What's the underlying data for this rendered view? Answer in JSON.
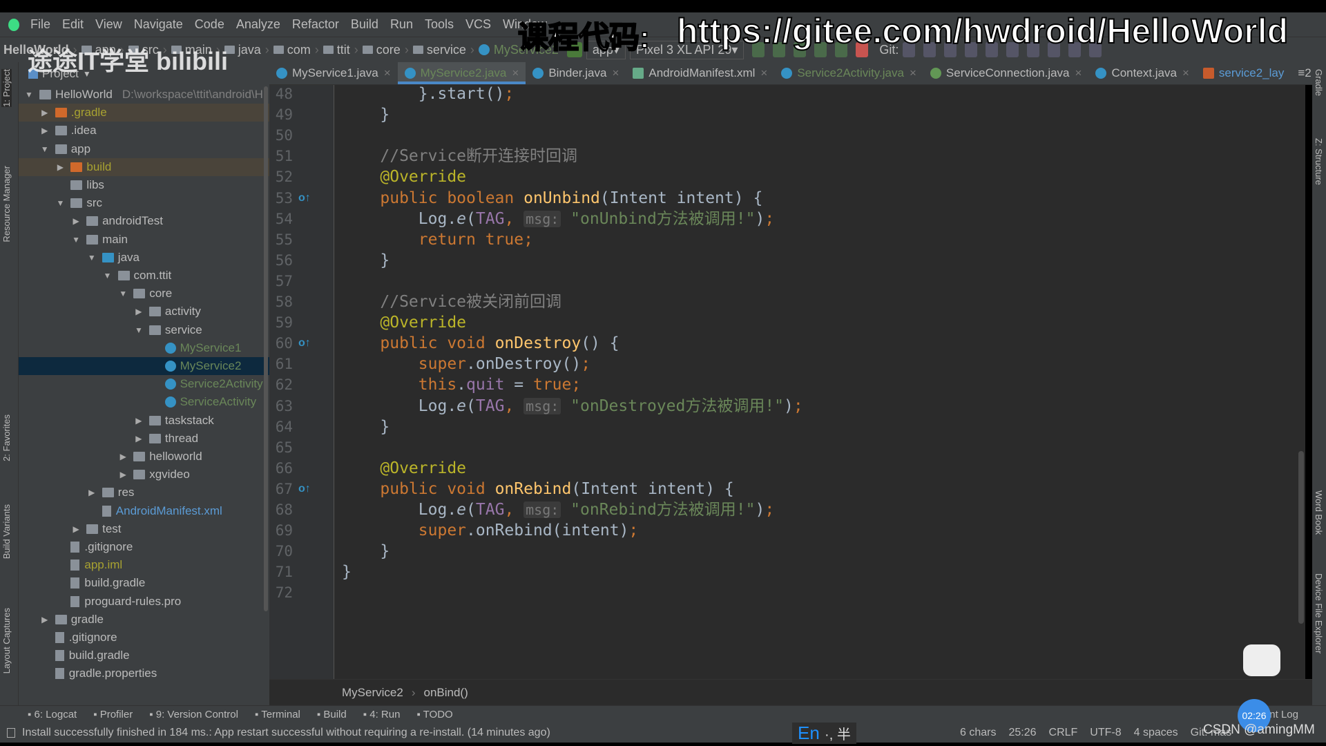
{
  "menu": [
    "File",
    "Edit",
    "View",
    "Navigate",
    "Code",
    "Analyze",
    "Refactor",
    "Build",
    "Run",
    "Tools",
    "VCS",
    "Window"
  ],
  "overlay": {
    "label": "课程代码:",
    "url": "https://gitee.com/hwdroid/HelloWorld",
    "logo": "途途IT学堂 bilibili"
  },
  "breadcrumb": [
    "HelloWorld",
    "app",
    "src",
    "main",
    "java",
    "com",
    "ttit",
    "core",
    "service",
    "MyService2"
  ],
  "toolbar": {
    "config": "app",
    "device": "Pixel 3 XL API 29",
    "git": "Git:"
  },
  "tabs": [
    {
      "label": "MyService1.java",
      "icon": "class-icon"
    },
    {
      "label": "MyService2.java",
      "icon": "class-icon",
      "active": true
    },
    {
      "label": "Binder.java",
      "icon": "class-icon"
    },
    {
      "label": "AndroidManifest.xml",
      "icon": "manifest-icon"
    },
    {
      "label": "Service2Activity.java",
      "icon": "class-icon"
    },
    {
      "label": "ServiceConnection.java",
      "icon": "interface-icon"
    },
    {
      "label": "Context.java",
      "icon": "class-icon"
    },
    {
      "label": "service2_lay",
      "icon": "layout-icon"
    }
  ],
  "tabs_overflow": "≡2",
  "project": {
    "title": "Project",
    "root_path": "D:\\workspace\\ttit\\android\\H",
    "rows": [
      {
        "d": 0,
        "a": "down",
        "t": "module",
        "label": "HelloWorld"
      },
      {
        "d": 1,
        "a": "right",
        "t": "folder-orange",
        "label": ".gradle",
        "color": "#a8a231",
        "excl": true
      },
      {
        "d": 1,
        "a": "right",
        "t": "folder",
        "label": ".idea"
      },
      {
        "d": 1,
        "a": "down",
        "t": "module",
        "label": "app"
      },
      {
        "d": 2,
        "a": "right",
        "t": "folder-orange",
        "label": "build",
        "color": "#a8a231",
        "excl": true
      },
      {
        "d": 2,
        "a": "",
        "t": "folder",
        "label": "libs"
      },
      {
        "d": 2,
        "a": "down",
        "t": "folder",
        "label": "src"
      },
      {
        "d": 3,
        "a": "right",
        "t": "folder",
        "label": "androidTest"
      },
      {
        "d": 3,
        "a": "down",
        "t": "folder",
        "label": "main"
      },
      {
        "d": 4,
        "a": "down",
        "t": "folder-blue",
        "label": "java"
      },
      {
        "d": 5,
        "a": "down",
        "t": "package",
        "label": "com.ttit"
      },
      {
        "d": 6,
        "a": "down",
        "t": "package",
        "label": "core"
      },
      {
        "d": 7,
        "a": "right",
        "t": "package",
        "label": "activity"
      },
      {
        "d": 7,
        "a": "down",
        "t": "package",
        "label": "service"
      },
      {
        "d": 8,
        "a": "",
        "t": "class",
        "label": "MyService1",
        "color": "#6a8759"
      },
      {
        "d": 8,
        "a": "",
        "t": "class",
        "label": "MyService2",
        "color": "#6a8759",
        "sel": true
      },
      {
        "d": 8,
        "a": "",
        "t": "class",
        "label": "Service2Activity",
        "color": "#6a8759"
      },
      {
        "d": 8,
        "a": "",
        "t": "class",
        "label": "ServiceActivity",
        "color": "#6a8759"
      },
      {
        "d": 7,
        "a": "right",
        "t": "package",
        "label": "taskstack"
      },
      {
        "d": 7,
        "a": "right",
        "t": "package",
        "label": "thread"
      },
      {
        "d": 6,
        "a": "right",
        "t": "package",
        "label": "helloworld"
      },
      {
        "d": 6,
        "a": "right",
        "t": "package",
        "label": "xgvideo"
      },
      {
        "d": 4,
        "a": "right",
        "t": "folder",
        "label": "res"
      },
      {
        "d": 4,
        "a": "",
        "t": "file",
        "label": "AndroidManifest.xml",
        "color": "#5b9bd5"
      },
      {
        "d": 3,
        "a": "right",
        "t": "folder",
        "label": "test"
      },
      {
        "d": 2,
        "a": "",
        "t": "file",
        "label": ".gitignore"
      },
      {
        "d": 2,
        "a": "",
        "t": "file",
        "label": "app.iml",
        "color": "#a8a231"
      },
      {
        "d": 2,
        "a": "",
        "t": "file",
        "label": "build.gradle"
      },
      {
        "d": 2,
        "a": "",
        "t": "file",
        "label": "proguard-rules.pro"
      },
      {
        "d": 1,
        "a": "right",
        "t": "folder",
        "label": "gradle"
      },
      {
        "d": 1,
        "a": "",
        "t": "file",
        "label": ".gitignore"
      },
      {
        "d": 1,
        "a": "",
        "t": "file",
        "label": "build.gradle"
      },
      {
        "d": 1,
        "a": "",
        "t": "file",
        "label": "gradle.properties"
      }
    ]
  },
  "left_strip": [
    "1: Project",
    "Resource Manager",
    "2: Favorites",
    "Build Variants",
    "Layout Captures"
  ],
  "right_strip": [
    "Gradle",
    "Z: Structure",
    "Word Book",
    "Device File Explorer"
  ],
  "code": [
    {
      "n": 48,
      "t": [
        [
          "        }.start()",
          ""
        ],
        [
          ";",
          "kw"
        ]
      ]
    },
    {
      "n": 49,
      "t": [
        [
          "    }",
          ""
        ]
      ]
    },
    {
      "n": 50,
      "t": []
    },
    {
      "n": 51,
      "t": [
        [
          "    //Service断开连接时回调",
          "cm"
        ]
      ]
    },
    {
      "n": 52,
      "t": [
        [
          "    @Override",
          "an"
        ]
      ]
    },
    {
      "n": 53,
      "o": true,
      "t": [
        [
          "    public boolean ",
          "kw"
        ],
        [
          "onUnbind",
          "fn"
        ],
        [
          "(Intent intent) {",
          ""
        ]
      ]
    },
    {
      "n": 54,
      "t": [
        [
          "        Log.",
          ""
        ],
        [
          "e",
          "it"
        ],
        [
          "(",
          ""
        ],
        [
          "TAG",
          "fld"
        ],
        [
          ", ",
          "kw"
        ],
        [
          "msg:",
          "hint"
        ],
        [
          "\"onUnbind方法被调用!\"",
          "str"
        ],
        [
          ")",
          ""
        ],
        [
          ";",
          "kw"
        ]
      ]
    },
    {
      "n": 55,
      "t": [
        [
          "        return true;",
          "kw"
        ]
      ]
    },
    {
      "n": 56,
      "t": [
        [
          "    }",
          ""
        ]
      ]
    },
    {
      "n": 57,
      "t": []
    },
    {
      "n": 58,
      "t": [
        [
          "    //Service被关闭前回调",
          "cm"
        ]
      ]
    },
    {
      "n": 59,
      "t": [
        [
          "    @Override",
          "an"
        ]
      ]
    },
    {
      "n": 60,
      "o": true,
      "t": [
        [
          "    public void ",
          "kw"
        ],
        [
          "onDestroy",
          "fn"
        ],
        [
          "() {",
          ""
        ]
      ]
    },
    {
      "n": 61,
      "t": [
        [
          "        super",
          "kw"
        ],
        [
          ".onDestroy()",
          ""
        ],
        [
          ";",
          "kw"
        ]
      ]
    },
    {
      "n": 62,
      "t": [
        [
          "        this",
          "kw"
        ],
        [
          ".",
          ""
        ],
        [
          "quit",
          "fld"
        ],
        [
          " = ",
          ""
        ],
        [
          "true;",
          "kw"
        ]
      ]
    },
    {
      "n": 63,
      "t": [
        [
          "        Log.",
          ""
        ],
        [
          "e",
          "it"
        ],
        [
          "(",
          ""
        ],
        [
          "TAG",
          "fld"
        ],
        [
          ", ",
          "kw"
        ],
        [
          "msg:",
          "hint"
        ],
        [
          "\"onDestroyed方法被调用!\"",
          "str"
        ],
        [
          ")",
          ""
        ],
        [
          ";",
          "kw"
        ]
      ]
    },
    {
      "n": 64,
      "t": [
        [
          "    }",
          ""
        ]
      ]
    },
    {
      "n": 65,
      "t": []
    },
    {
      "n": 66,
      "t": [
        [
          "    @Override",
          "an"
        ]
      ]
    },
    {
      "n": 67,
      "o": true,
      "t": [
        [
          "    public void ",
          "kw"
        ],
        [
          "onRebind",
          "fn"
        ],
        [
          "(Intent intent) {",
          ""
        ]
      ]
    },
    {
      "n": 68,
      "t": [
        [
          "        Log.",
          ""
        ],
        [
          "e",
          "it"
        ],
        [
          "(",
          ""
        ],
        [
          "TAG",
          "fld"
        ],
        [
          ", ",
          "kw"
        ],
        [
          "msg:",
          "hint"
        ],
        [
          "\"onRebind方法被调用!\"",
          "str"
        ],
        [
          ")",
          ""
        ],
        [
          ";",
          "kw"
        ]
      ]
    },
    {
      "n": 69,
      "t": [
        [
          "        super",
          "kw"
        ],
        [
          ".onRebind(intent)",
          ""
        ],
        [
          ";",
          "kw"
        ]
      ]
    },
    {
      "n": 70,
      "t": [
        [
          "    }",
          ""
        ]
      ]
    },
    {
      "n": 71,
      "t": [
        [
          "}",
          ""
        ]
      ]
    },
    {
      "n": 72,
      "t": []
    }
  ],
  "editor_crumbs": [
    "MyService2",
    "onBind()"
  ],
  "tool_windows": [
    "6: Logcat",
    "Profiler",
    "9: Version Control",
    "Terminal",
    "Build",
    "4: Run",
    "TODO"
  ],
  "event_log": "Event Log",
  "status": {
    "message": "Install successfully finished in 184 ms.: App restart successful without requiring a re-install. (14 minutes ago)",
    "chars": "6 chars",
    "pos": "25:26",
    "eol": "CRLF",
    "enc": "UTF-8",
    "indent": "4 spaces",
    "git": "Git: mas",
    "ime": "En",
    "ime_rest": "·, 半",
    "timer": "02:26",
    "watermark": "CSDN @amingMM"
  }
}
